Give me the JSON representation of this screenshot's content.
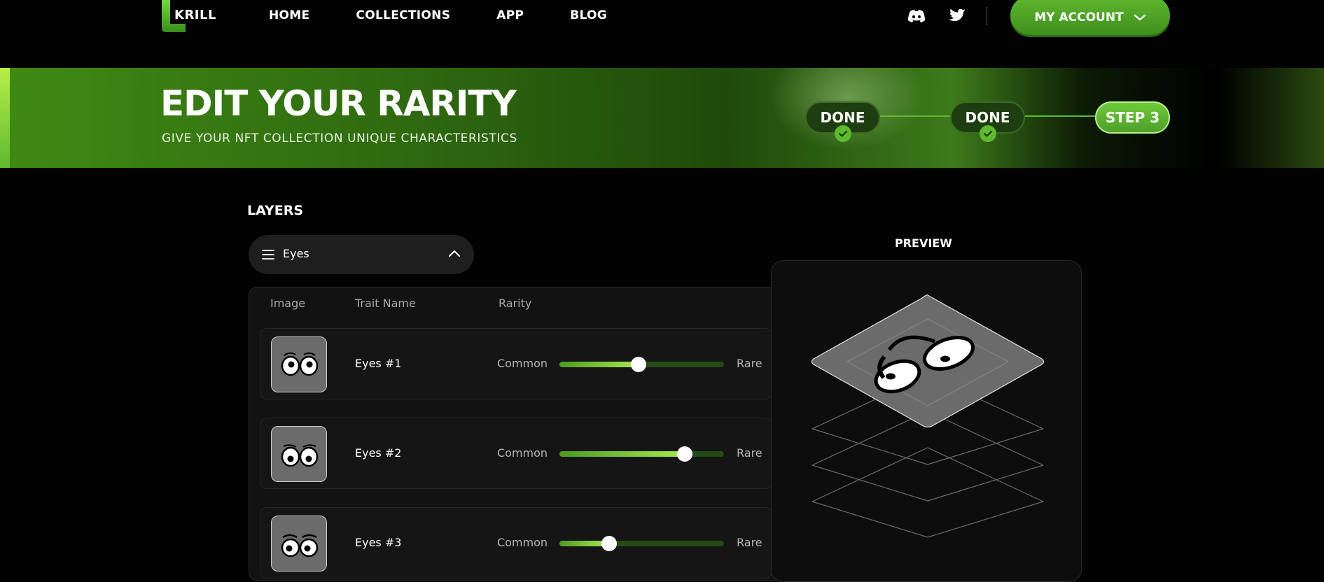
{
  "brand": {
    "name": "KRILL"
  },
  "nav": {
    "links": [
      "HOME",
      "COLLECTIONS",
      "APP",
      "BLOG"
    ],
    "account_label": "MY ACCOUNT",
    "social_icons": [
      "discord-icon",
      "twitter-icon"
    ]
  },
  "banner": {
    "title": "EDIT YOUR RARITY",
    "subtitle": "GIVE YOUR NFT COLLECTION UNIQUE CHARACTERISTICS",
    "steps": [
      {
        "label": "DONE",
        "state": "done"
      },
      {
        "label": "DONE",
        "state": "done"
      },
      {
        "label": "STEP 3",
        "state": "active"
      }
    ]
  },
  "layers": {
    "heading": "LAYERS",
    "selected": "Eyes",
    "columns": {
      "image": "Image",
      "name": "Trait Name",
      "rarity": "Rarity"
    },
    "scale_low": "Common",
    "scale_high": "Rare",
    "traits": [
      {
        "name": "Eyes #1",
        "rarity": 0.48
      },
      {
        "name": "Eyes #2",
        "rarity": 0.76
      },
      {
        "name": "Eyes #3",
        "rarity": 0.3
      }
    ]
  },
  "preview": {
    "heading": "PREVIEW"
  },
  "colors": {
    "accent": "#5fb92e",
    "accent_light": "#a6e84e",
    "background": "#020202"
  }
}
